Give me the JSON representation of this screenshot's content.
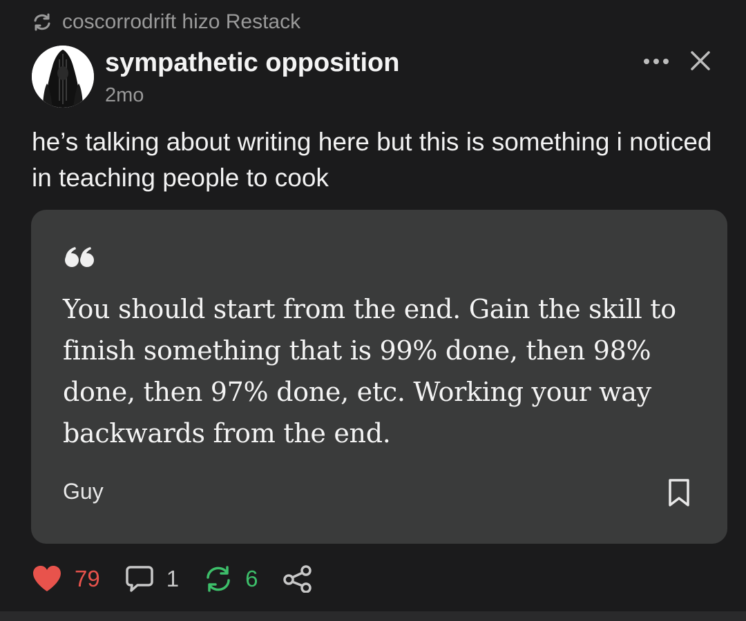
{
  "restack": {
    "icon": "restack-arrows-icon",
    "text": "coscorrodrift hizo Restack"
  },
  "post": {
    "author": "sympathetic opposition",
    "time": "2mo",
    "text": "he’s talking about writing here but this is something i noticed in teaching people to cook"
  },
  "quote": {
    "text": "You should start from the end. Gain the skill to finish something that is 99% done, then 98% done, then 97% done, etc. Working your way backwards from the end.",
    "author": "Guy"
  },
  "actions": {
    "likes": "79",
    "comments": "1",
    "restacks": "6"
  },
  "colors": {
    "background": "#1b1b1c",
    "card": "#3a3b3b",
    "like": "#e8534c",
    "restack": "#3dbf6a",
    "muted": "#9a9a9a"
  }
}
